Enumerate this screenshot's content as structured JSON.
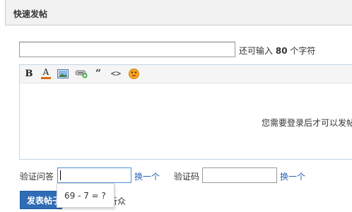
{
  "panel": {
    "title": "快速发帖"
  },
  "subject": {
    "value": "",
    "remaining_prefix": "还可输入",
    "remaining_count": "80",
    "remaining_suffix": "个字符"
  },
  "toolbar": {
    "buttons": [
      {
        "icon": "bold-icon",
        "glyph": "B"
      },
      {
        "icon": "font-color-icon",
        "glyph": "A"
      },
      {
        "icon": "image-icon"
      },
      {
        "icon": "link-icon"
      },
      {
        "icon": "quote-icon",
        "glyph": "“"
      },
      {
        "icon": "code-icon",
        "glyph": "<>"
      },
      {
        "icon": "smiley-icon"
      }
    ]
  },
  "editor": {
    "message": "您需要登录后才可以发帖"
  },
  "captcha": {
    "question_label": "验证问答",
    "question_value": "",
    "question_change": "换一个",
    "code_label": "验证码",
    "code_value": "",
    "code_change": "换一个",
    "question_tooltip": "69 - 7 = ?"
  },
  "footer": {
    "submit_label": "发表帖子",
    "tail_text": "听众"
  },
  "colors": {
    "accent": "#2e6cb5",
    "link": "#2b63b5",
    "header_bg": "#f2f2f2"
  }
}
